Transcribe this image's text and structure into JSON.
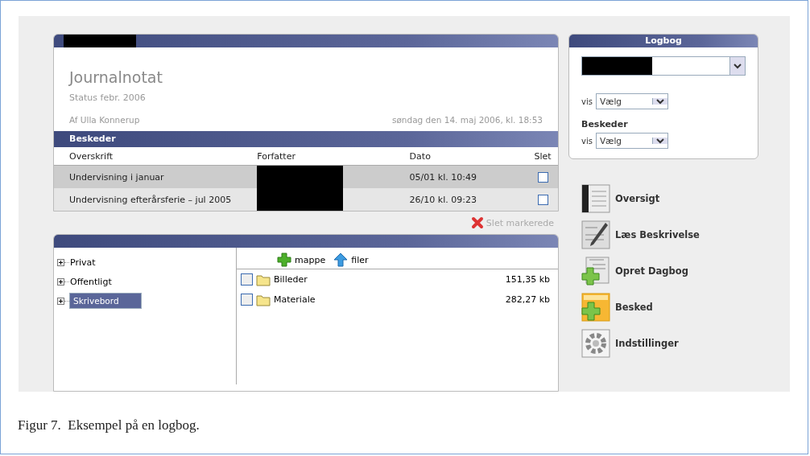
{
  "journal": {
    "title": "Journalnotat",
    "subtitle": "Status febr. 2006",
    "author": "Af Ulla Konnerup",
    "date": "søndag den 14. maj 2006, kl. 18:53"
  },
  "messages": {
    "title": "Beskeder",
    "columns": [
      "Overskrift",
      "Forfatter",
      "Dato",
      "Slet"
    ],
    "rows": [
      {
        "subject": "Undervisning i januar",
        "date": "05/01  kl. 10:49",
        "checked": false
      },
      {
        "subject": "Undervisning efterårsferie – jul 2005",
        "date": "26/10  kl. 09:23",
        "checked": false
      }
    ],
    "delete_label": "Slet markerede"
  },
  "folders": {
    "tree": [
      {
        "label": "Privat",
        "expanded": false,
        "selected": false
      },
      {
        "label": "Offentligt",
        "expanded": false,
        "selected": false
      },
      {
        "label": "Skrivebord",
        "expanded": false,
        "selected": true
      }
    ],
    "actions": [
      {
        "kind": "add",
        "label": "mappe"
      },
      {
        "kind": "upload",
        "label": "filer"
      }
    ],
    "files": [
      {
        "name": "Billeder",
        "size": "151,35 kb",
        "checked": false
      },
      {
        "name": "Materiale",
        "size": "282,27 kb",
        "checked": false
      }
    ]
  },
  "logbook": {
    "title": "Logbog",
    "vis_label_1": "vis",
    "select_1": "Vælg",
    "messages_heading": "Beskeder",
    "vis_label_2": "vis",
    "select_2": "Vælg"
  },
  "nav": [
    {
      "kind": "overview",
      "label": "Oversigt"
    },
    {
      "kind": "read",
      "label": "Læs Beskrivelse"
    },
    {
      "kind": "create",
      "label": "Opret Dagbog"
    },
    {
      "kind": "message",
      "label": "Besked"
    },
    {
      "kind": "settings",
      "label": "Indstillinger"
    }
  ],
  "caption": "Figur 7.  Eksempel på en logbog."
}
